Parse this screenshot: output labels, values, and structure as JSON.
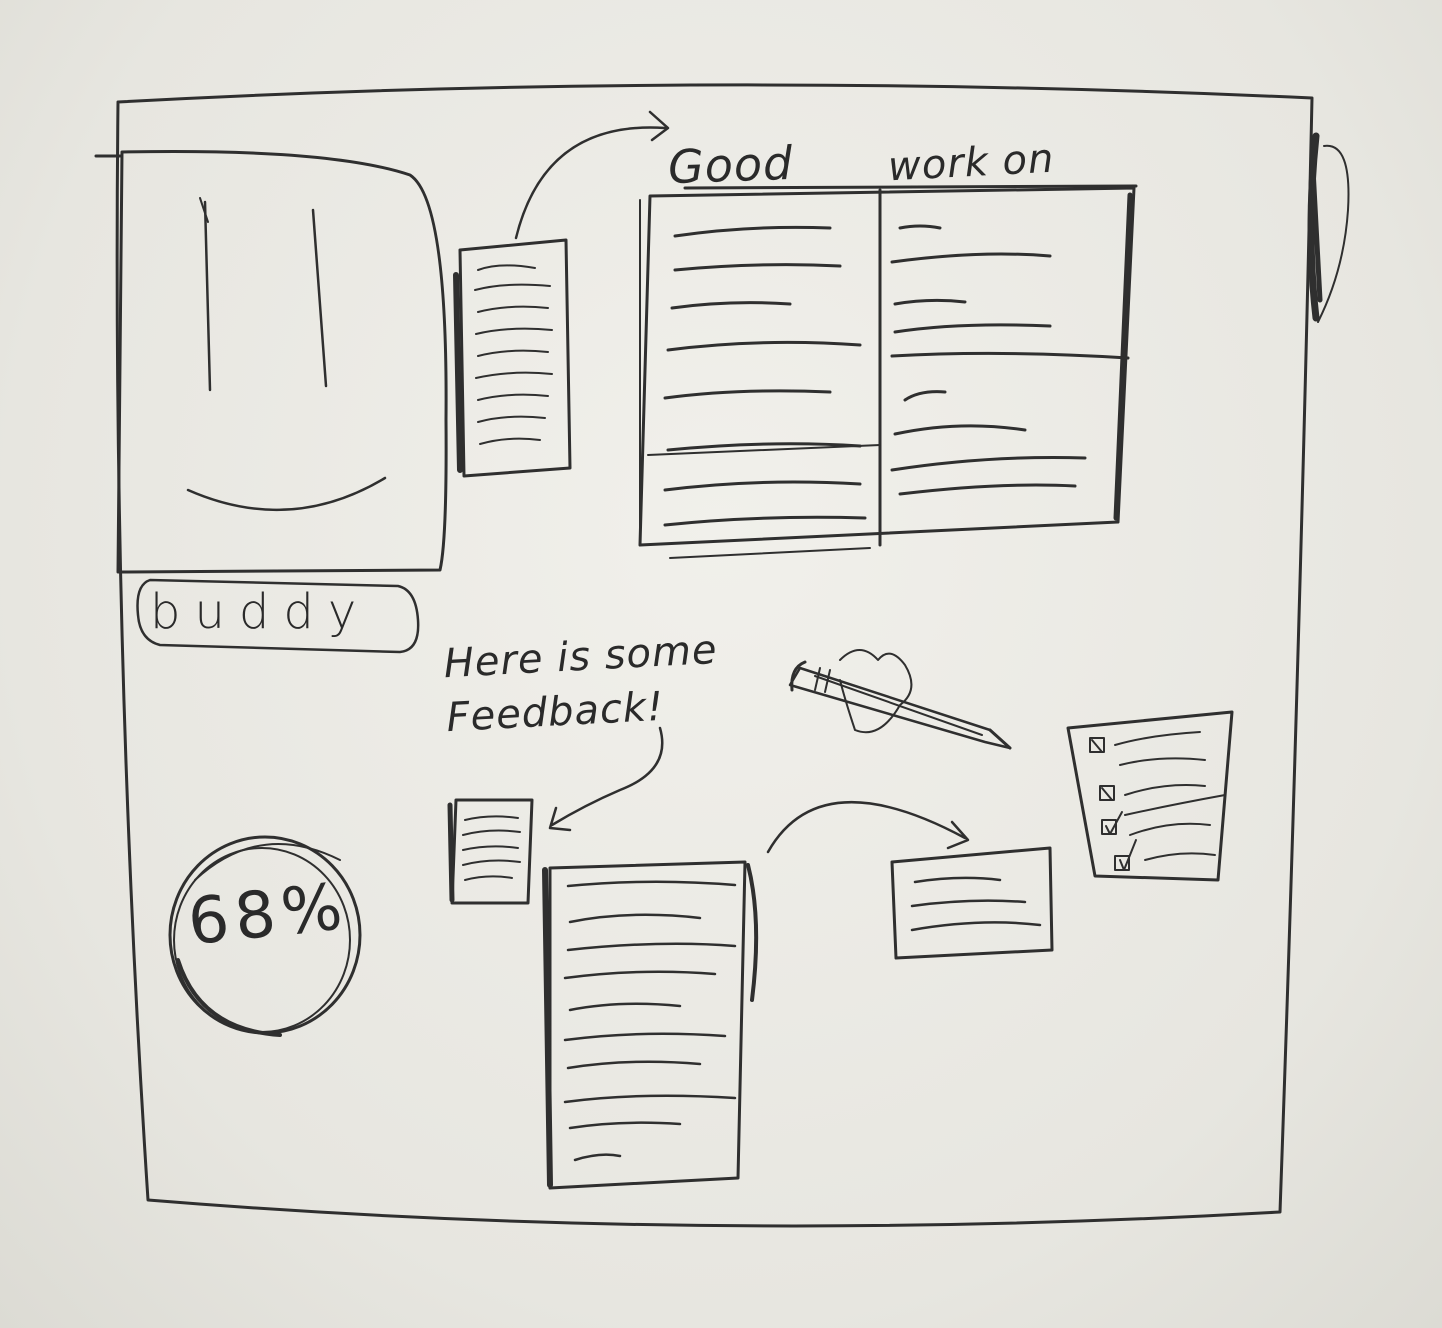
{
  "buddy": {
    "name_label": "buddy"
  },
  "progress": {
    "value_label": "68%",
    "value": 68
  },
  "columns": {
    "good_header": "Good",
    "work_on_header": "work on"
  },
  "feedback": {
    "heading_line1": "Here is some",
    "heading_line2": "Feedback!"
  },
  "icons": {
    "edit": "pencil-icon",
    "checklist": "checklist-icon"
  },
  "colors": {
    "paper": "#ecebe6",
    "ink": "#2b2b2b"
  }
}
